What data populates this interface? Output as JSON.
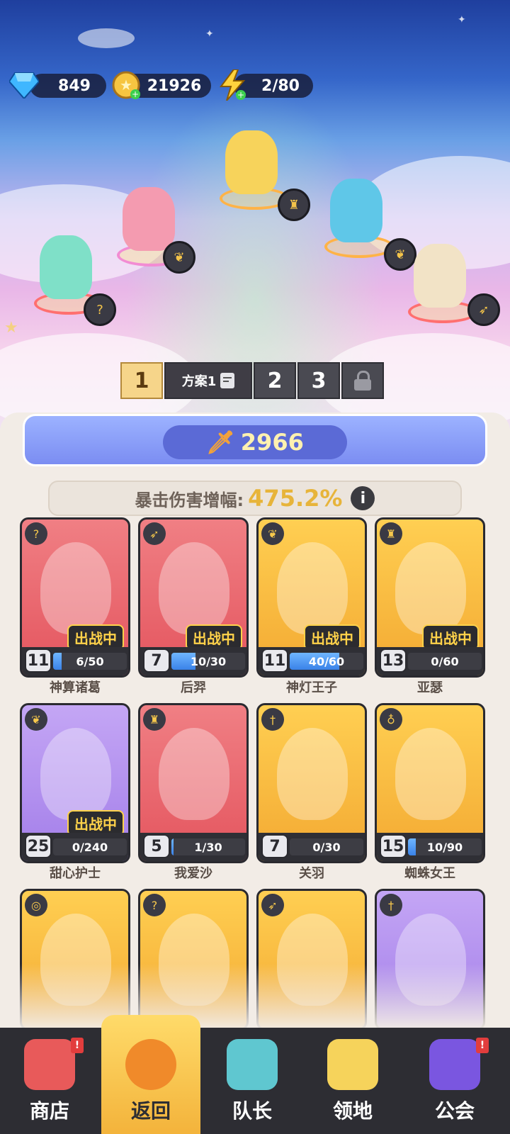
{
  "resources": {
    "gems": {
      "icon": "diamond-icon",
      "value": "849"
    },
    "coins": {
      "icon": "coin-icon",
      "value": "21926"
    },
    "energy": {
      "icon": "lightning-icon",
      "value": "2/80"
    }
  },
  "plans": {
    "active": "1",
    "active_name": "方案1",
    "others": [
      "2",
      "3"
    ],
    "locked_icon": "lock-icon"
  },
  "power": {
    "icon": "sword-icon",
    "value": "2966"
  },
  "crit": {
    "label": "暴击伤害增幅:",
    "value": "475.2%",
    "info_icon": "info-icon",
    "info_glyph": "i"
  },
  "deploy_label": "出战中",
  "heroes": [
    {
      "name": "神算诸葛",
      "level": "11",
      "progress": "6/50",
      "fill": 0.12,
      "deployed": true,
      "bg": "red",
      "class_icon": "magic-staff-icon"
    },
    {
      "name": "后羿",
      "level": "7",
      "progress": "10/30",
      "fill": 0.33,
      "deployed": true,
      "bg": "red",
      "class_icon": "bow-icon"
    },
    {
      "name": "神灯王子",
      "level": "11",
      "progress": "40/60",
      "fill": 0.67,
      "deployed": true,
      "bg": "yellow",
      "class_icon": "wings-icon"
    },
    {
      "name": "亚瑟",
      "level": "13",
      "progress": "0/60",
      "fill": 0,
      "deployed": true,
      "bg": "yellow",
      "class_icon": "horned-helmet-icon"
    },
    {
      "name": "甜心护士",
      "level": "25",
      "progress": "0/240",
      "fill": 0,
      "deployed": true,
      "bg": "purple",
      "class_icon": "wings-icon"
    },
    {
      "name": "我爱沙",
      "level": "5",
      "progress": "1/30",
      "fill": 0.03,
      "deployed": false,
      "bg": "red",
      "class_icon": "horned-helmet-icon"
    },
    {
      "name": "关羽",
      "level": "7",
      "progress": "0/30",
      "fill": 0,
      "deployed": false,
      "bg": "yellow",
      "class_icon": "dagger-icon"
    },
    {
      "name": "蜘蛛女王",
      "level": "15",
      "progress": "10/90",
      "fill": 0.11,
      "deployed": false,
      "bg": "yellow",
      "class_icon": "potion-icon"
    },
    {
      "bg": "yellow",
      "class_icon": "swirl-icon"
    },
    {
      "bg": "yellow",
      "class_icon": "magic-staff-icon"
    },
    {
      "bg": "yellow",
      "class_icon": "bow-icon"
    },
    {
      "bg": "purple",
      "class_icon": "dagger-icon"
    }
  ],
  "nav": [
    {
      "label": "商店",
      "icon": "shop-icon",
      "alert": true
    },
    {
      "label": "返回",
      "icon": "return-icon",
      "active": true
    },
    {
      "label": "队长",
      "icon": "captain-icon"
    },
    {
      "label": "领地",
      "icon": "territory-icon"
    },
    {
      "label": "公会",
      "icon": "guild-icon",
      "alert": true
    }
  ],
  "alert_glyph": "!",
  "colors": {
    "accent": "#f3b33b",
    "power_text": "#fff1b0",
    "crit_value": "#e7b43a",
    "nav_bg": "#2d2d33"
  }
}
